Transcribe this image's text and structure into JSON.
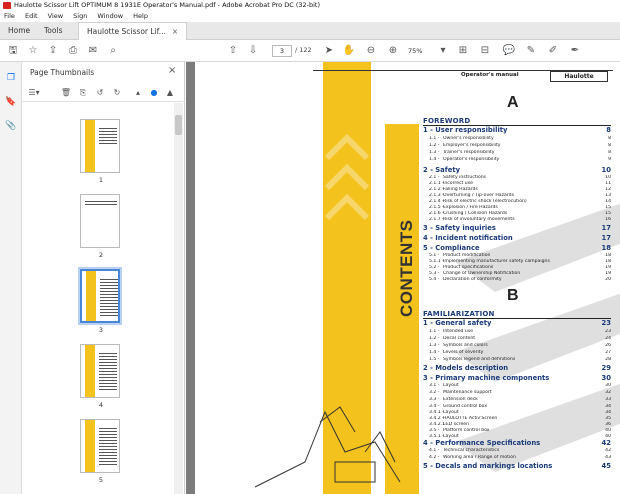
{
  "window": {
    "title": "Haulotte Scissor Lift OPTIMUM 8 1931E Operator's Manual.pdf - Adobe Acrobat Pro DC (32-bit)"
  },
  "menu": [
    "File",
    "Edit",
    "View",
    "Sign",
    "Window",
    "Help"
  ],
  "tabs": {
    "home": "Home",
    "tools": "Tools",
    "document": "Haulotte Scissor Lif...",
    "close": "×"
  },
  "toolbar": {
    "page_current": "3",
    "page_total": "/ 122",
    "zoom": "75%"
  },
  "panel": {
    "title": "Page Thumbnails",
    "close": "×",
    "thumb_labels": [
      "1",
      "2",
      "3",
      "4",
      "5"
    ]
  },
  "doc": {
    "header_manual": "Operator's manual",
    "brand": "Haulotte",
    "contents": "CONTENTS",
    "letter_a": "A",
    "letter_b": "B",
    "foreword": "FOREWORD",
    "familiarization": "FAMILIARIZATION",
    "sections_a": [
      {
        "title": "1 - User responsibility",
        "page": "8"
      },
      {
        "title": "2 - Safety",
        "page": "10"
      },
      {
        "title": "3 - Safety inquiries",
        "page": "17"
      },
      {
        "title": "4 - Incident notification",
        "page": "17"
      },
      {
        "title": "5 - Compliance",
        "page": "18"
      }
    ],
    "entries_a1": [
      {
        "n": "1.1 -",
        "t": "Owner's responsibility",
        "p": "8"
      },
      {
        "n": "1.2 -",
        "t": "Employer's responsibility",
        "p": "8"
      },
      {
        "n": "1.3 -",
        "t": "Trainer's responsibility",
        "p": "8"
      },
      {
        "n": "1.4 -",
        "t": "Operator's responsibility",
        "p": "9"
      }
    ],
    "entries_a2": [
      {
        "n": "2.1 -",
        "t": "Safety instructions",
        "p": "10"
      },
      {
        "n": "2.1.1 -",
        "t": "Incorrect use",
        "p": "11"
      },
      {
        "n": "2.1.2 -",
        "t": "Falling Hazards",
        "p": "12"
      },
      {
        "n": "2.1.3 -",
        "t": "Overturning / Tip-over Hazards",
        "p": "13"
      },
      {
        "n": "2.1.4 -",
        "t": "Risk of electric shock (electrocution)",
        "p": "14"
      },
      {
        "n": "2.1.5 -",
        "t": "Explosion / Fire Hazards",
        "p": "15"
      },
      {
        "n": "2.1.6 -",
        "t": "Crushing / Collision Hazards",
        "p": "15"
      },
      {
        "n": "2.1.7 -",
        "t": "Risk of involuntary movements",
        "p": "16"
      }
    ],
    "entries_a5": [
      {
        "n": "5.1 -",
        "t": "Product modification",
        "p": "18"
      },
      {
        "n": "5.1.1 -",
        "t": "Implementing manufacturer safety campaigns",
        "p": "18"
      },
      {
        "n": "5.2 -",
        "t": "Product specifications",
        "p": "19"
      },
      {
        "n": "5.3 -",
        "t": "Change of Ownership Notification",
        "p": "19"
      },
      {
        "n": "5.4 -",
        "t": "Declaration of conformity",
        "p": "20"
      }
    ],
    "sections_b": [
      {
        "title": "1 - General safety",
        "page": "23"
      },
      {
        "title": "2 - Models description",
        "page": "29"
      },
      {
        "title": "3 - Primary machine components",
        "page": "30"
      },
      {
        "title": "4 - Performance Specifications",
        "page": "42"
      },
      {
        "title": "5 - Decals and markings locations",
        "page": "45"
      }
    ],
    "entries_b1": [
      {
        "n": "1.1 -",
        "t": "Intended use",
        "p": "23"
      },
      {
        "n": "1.2 -",
        "t": "Decal content",
        "p": "24"
      },
      {
        "n": "1.3 -",
        "t": "Symbols and colors",
        "p": "26"
      },
      {
        "n": "1.4 -",
        "t": "Levels of severity",
        "p": "27"
      },
      {
        "n": "1.5 -",
        "t": "Symbols legend and definitions",
        "p": "28"
      }
    ],
    "entries_b3": [
      {
        "n": "3.1 -",
        "t": "Layout",
        "p": "30"
      },
      {
        "n": "3.2 -",
        "t": "Maintenance support",
        "p": "32"
      },
      {
        "n": "3.3 -",
        "t": "Extension deck",
        "p": "33"
      },
      {
        "n": "3.4 -",
        "t": "Ground control box",
        "p": "34"
      },
      {
        "n": "3.4.1 -",
        "t": "Layout",
        "p": "34"
      },
      {
        "n": "3.4.2 -",
        "t": "HAULOTTE Activ'Screen",
        "p": "35"
      },
      {
        "n": "3.4.2.1 -",
        "t": "LCD screen",
        "p": "36"
      },
      {
        "n": "3.5 -",
        "t": "Platform control box",
        "p": "40"
      },
      {
        "n": "3.5.1 -",
        "t": "Layout",
        "p": "40"
      }
    ],
    "entries_b4": [
      {
        "n": "4.1 -",
        "t": "Technical characteristics",
        "p": "42"
      },
      {
        "n": "4.2 -",
        "t": "Working area / Range of motion",
        "p": "43"
      }
    ]
  },
  "colors": {
    "accent": "#f3c21c",
    "heading": "#1a3a7a",
    "selection": "#4a86d8"
  }
}
